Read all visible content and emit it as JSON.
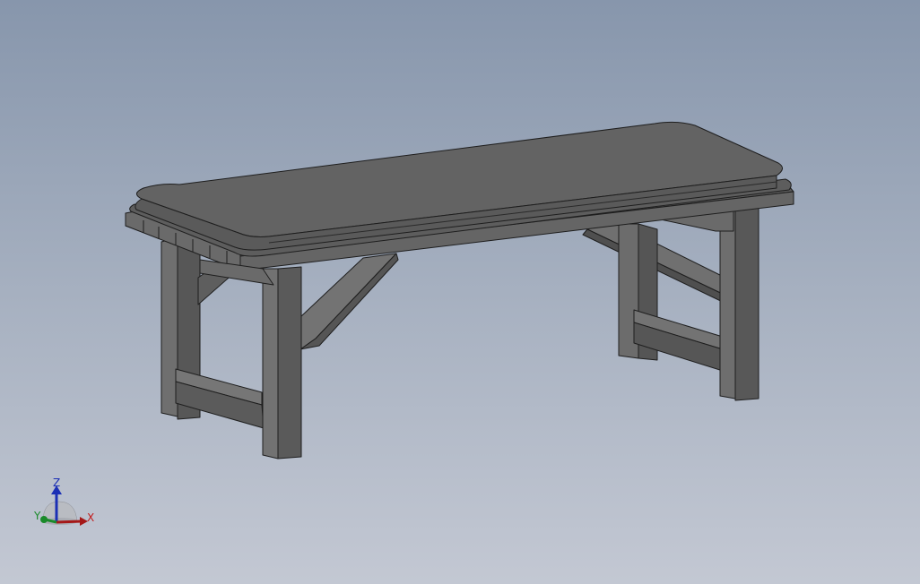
{
  "viewport": {
    "background_top": "#8796ac",
    "background_bottom": "#c3c8d3",
    "model_color": "#606060"
  },
  "model": {
    "name": "bench"
  },
  "triad": {
    "x_label": "X",
    "y_label": "Y",
    "z_label": "Z",
    "x_color": "#c21b1b",
    "y_color": "#1a8a2a",
    "z_color": "#1b2fb5"
  }
}
